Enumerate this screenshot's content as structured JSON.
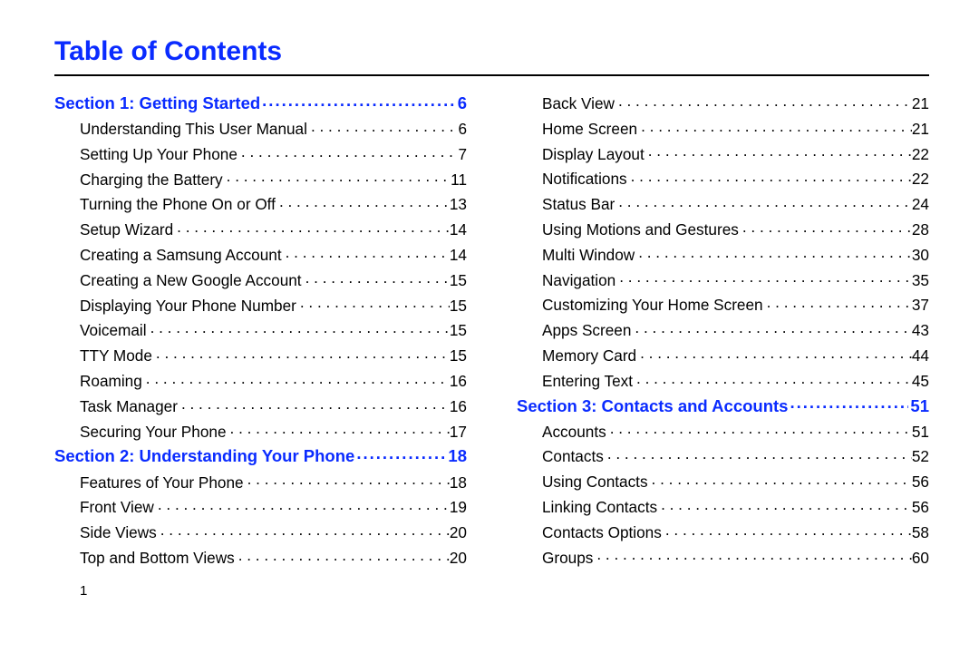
{
  "title": "Table of Contents",
  "footerPage": "1",
  "columns": [
    [
      {
        "type": "section",
        "label": "Section 1:  Getting Started",
        "page": "6"
      },
      {
        "type": "entry",
        "label": "Understanding This User Manual",
        "page": "6"
      },
      {
        "type": "entry",
        "label": "Setting Up Your Phone",
        "page": "7"
      },
      {
        "type": "entry",
        "label": "Charging the Battery",
        "page": "11"
      },
      {
        "type": "entry",
        "label": "Turning the Phone On or Off",
        "page": "13"
      },
      {
        "type": "entry",
        "label": "Setup Wizard",
        "page": "14"
      },
      {
        "type": "entry",
        "label": "Creating a Samsung Account",
        "page": "14"
      },
      {
        "type": "entry",
        "label": "Creating a New Google Account",
        "page": "15"
      },
      {
        "type": "entry",
        "label": "Displaying Your Phone Number",
        "page": "15"
      },
      {
        "type": "entry",
        "label": "Voicemail",
        "page": "15"
      },
      {
        "type": "entry",
        "label": "TTY Mode",
        "page": "15"
      },
      {
        "type": "entry",
        "label": "Roaming",
        "page": "16"
      },
      {
        "type": "entry",
        "label": "Task Manager",
        "page": "16"
      },
      {
        "type": "entry",
        "label": "Securing Your Phone",
        "page": "17"
      },
      {
        "type": "section",
        "label": "Section 2:  Understanding Your Phone",
        "page": "18"
      },
      {
        "type": "entry",
        "label": "Features of Your Phone",
        "page": "18"
      },
      {
        "type": "entry",
        "label": "Front View",
        "page": "19"
      },
      {
        "type": "entry",
        "label": "Side Views",
        "page": "20"
      },
      {
        "type": "entry",
        "label": "Top and Bottom Views",
        "page": "20"
      }
    ],
    [
      {
        "type": "entry",
        "label": "Back View",
        "page": "21"
      },
      {
        "type": "entry",
        "label": "Home Screen",
        "page": "21"
      },
      {
        "type": "entry",
        "label": "Display Layout",
        "page": "22"
      },
      {
        "type": "entry",
        "label": "Notifications",
        "page": "22"
      },
      {
        "type": "entry",
        "label": "Status Bar",
        "page": "24"
      },
      {
        "type": "entry",
        "label": "Using Motions and Gestures",
        "page": "28"
      },
      {
        "type": "entry",
        "label": "Multi Window",
        "page": "30"
      },
      {
        "type": "entry",
        "label": "Navigation",
        "page": "35"
      },
      {
        "type": "entry",
        "label": "Customizing Your Home Screen",
        "page": "37"
      },
      {
        "type": "entry",
        "label": "Apps Screen",
        "page": "43"
      },
      {
        "type": "entry",
        "label": "Memory Card",
        "page": "44"
      },
      {
        "type": "entry",
        "label": "Entering Text",
        "page": "45"
      },
      {
        "type": "section",
        "label": "Section 3:  Contacts and Accounts",
        "page": "51"
      },
      {
        "type": "entry",
        "label": "Accounts",
        "page": "51"
      },
      {
        "type": "entry",
        "label": "Contacts",
        "page": "52"
      },
      {
        "type": "entry",
        "label": "Using Contacts",
        "page": "56"
      },
      {
        "type": "entry",
        "label": "Linking Contacts",
        "page": "56"
      },
      {
        "type": "entry",
        "label": "Contacts Options",
        "page": "58"
      },
      {
        "type": "entry",
        "label": "Groups",
        "page": "60"
      }
    ]
  ]
}
